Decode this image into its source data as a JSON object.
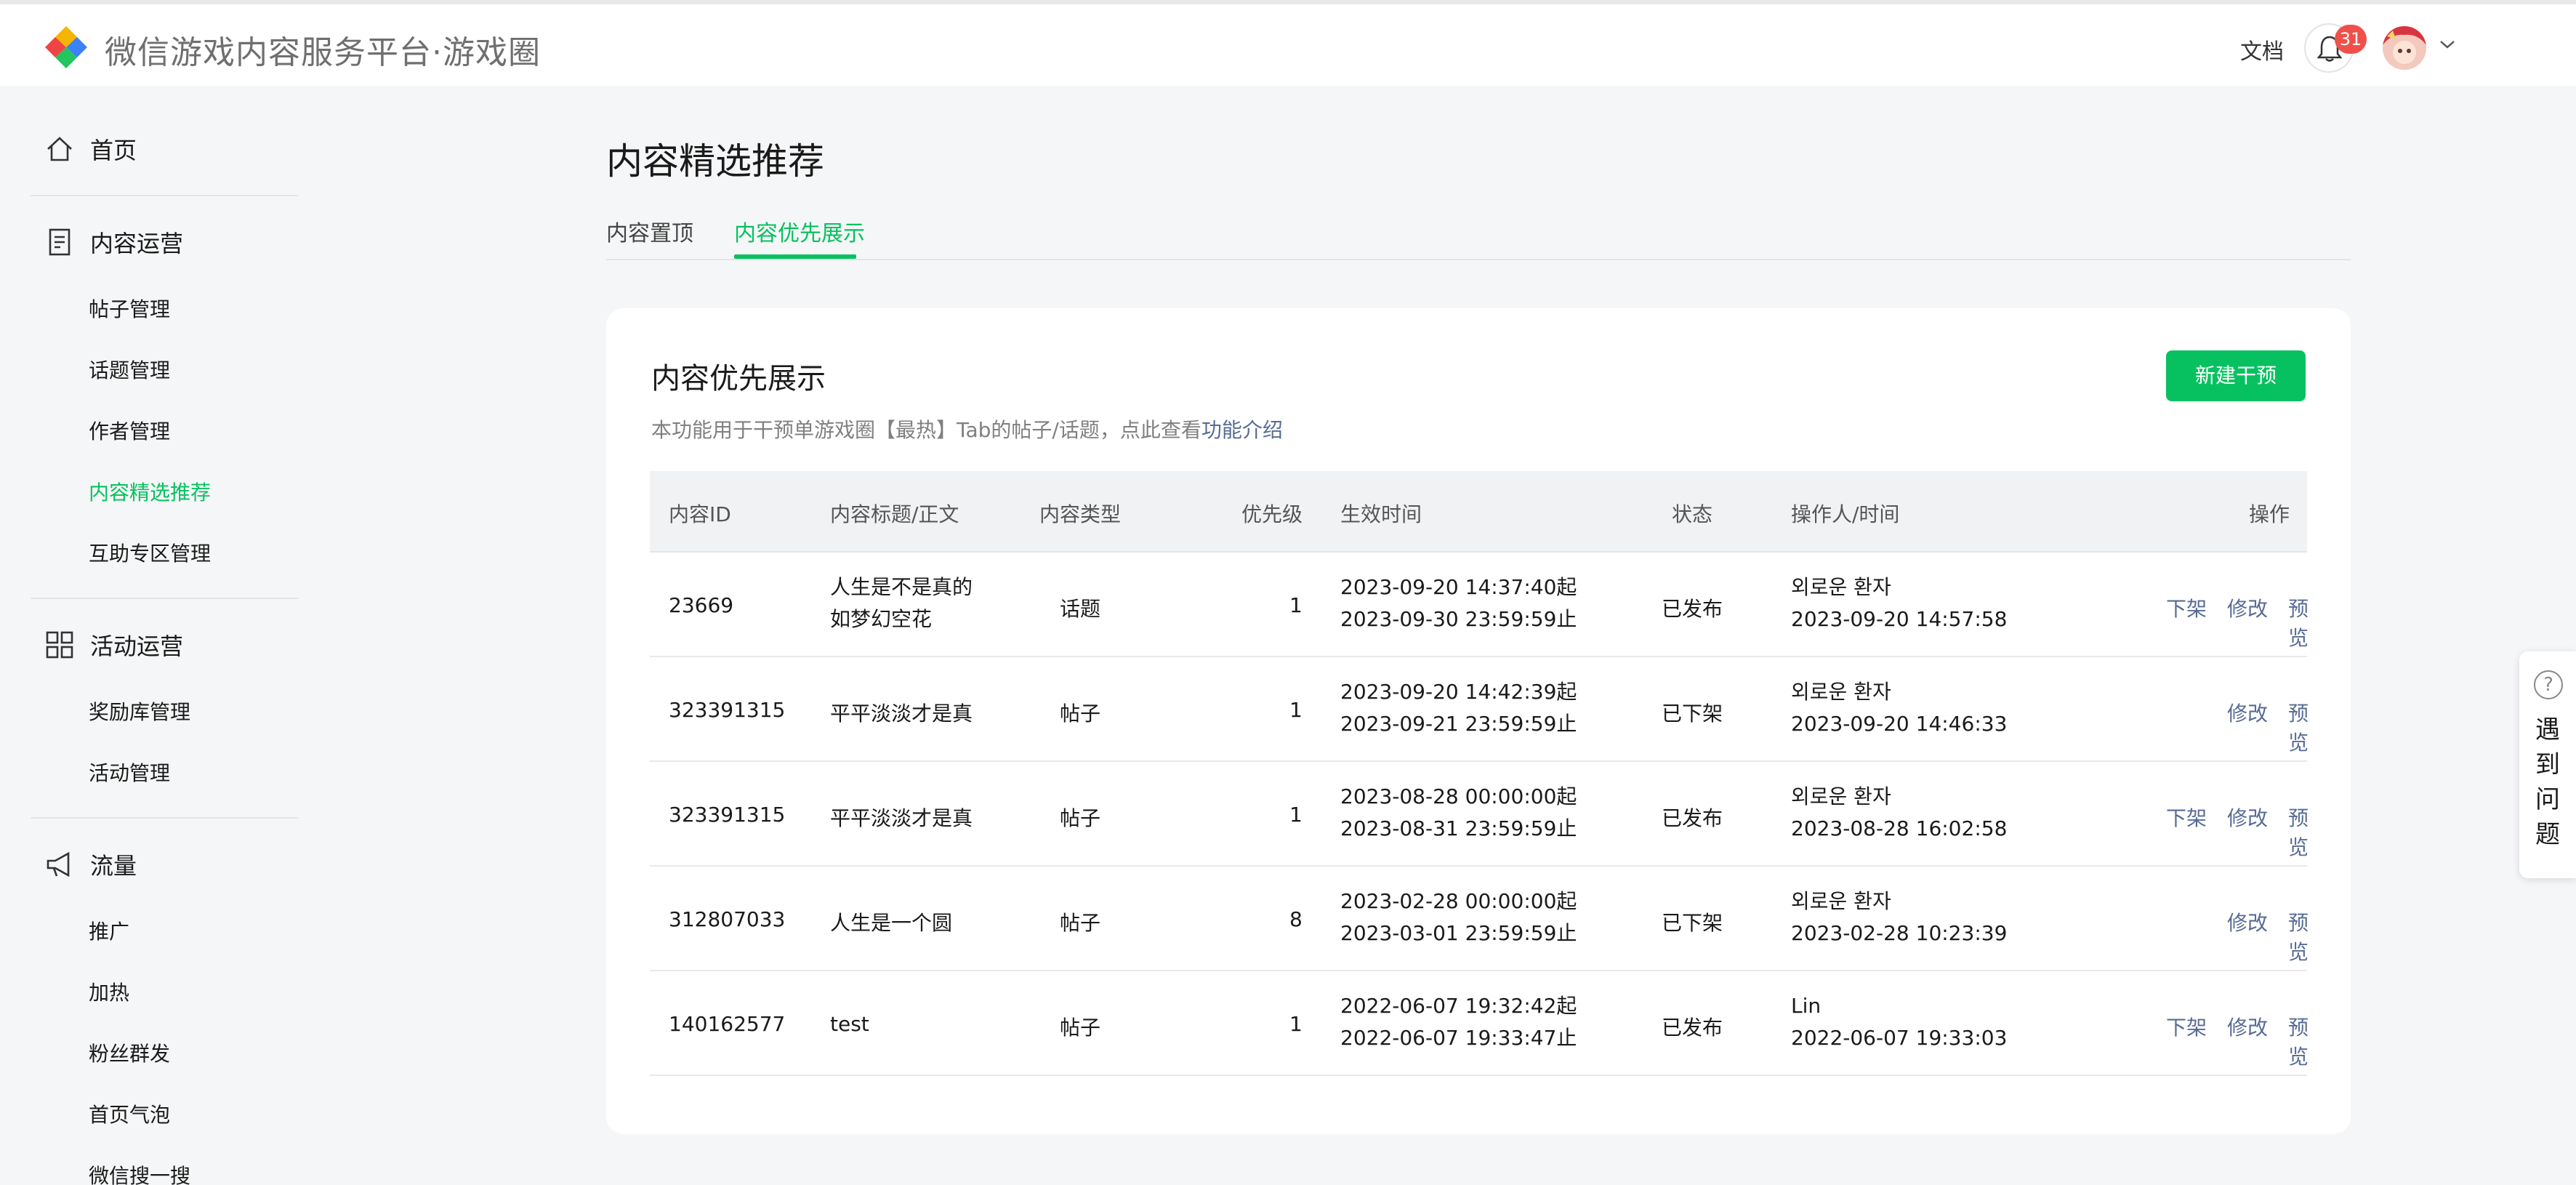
{
  "header": {
    "app_title": "微信游戏内容服务平台·游戏圈",
    "doc_link": "文档",
    "notification_count": "31"
  },
  "sidebar": {
    "home": "首页",
    "groups": [
      {
        "title": "内容运营",
        "icon": "document-icon",
        "items": [
          "帖子管理",
          "话题管理",
          "作者管理",
          "内容精选推荐",
          "互助专区管理"
        ]
      },
      {
        "title": "活动运营",
        "icon": "grid-icon",
        "items": [
          "奖励库管理",
          "活动管理"
        ]
      },
      {
        "title": "流量",
        "icon": "megaphone-icon",
        "items": [
          "推广",
          "加热",
          "粉丝群发",
          "首页气泡",
          "微信搜一搜"
        ]
      }
    ],
    "active_item": "内容精选推荐"
  },
  "main": {
    "page_title": "内容精选推荐",
    "tabs": [
      {
        "label": "内容置顶",
        "active": false
      },
      {
        "label": "内容优先展示",
        "active": true
      }
    ],
    "card": {
      "title": "内容优先展示",
      "desc_prefix": "本功能用于干预单游戏圈【最热】Tab的帖子/话题，点此查看",
      "desc_link": "功能介绍",
      "new_button": "新建干预"
    },
    "table": {
      "columns": [
        "内容ID",
        "内容标题/正文",
        "内容类型",
        "优先级",
        "生效时间",
        "状态",
        "操作人/时间",
        "操作"
      ],
      "rows": [
        {
          "id": "23669",
          "title1": "人生是不是真的",
          "title2": "如梦幻空花",
          "type": "话题",
          "priority": "1",
          "start": "2023-09-20 14:37:40起",
          "end": "2023-09-30 23:59:59止",
          "status": "已发布",
          "operator": "외로운 환자",
          "op_time": "2023-09-20 14:57:58",
          "actions": [
            "下架",
            "修改",
            "预览"
          ]
        },
        {
          "id": "323391315",
          "title1": "平平淡淡才是真",
          "title2": "",
          "type": "帖子",
          "priority": "1",
          "start": "2023-09-20 14:42:39起",
          "end": "2023-09-21 23:59:59止",
          "status": "已下架",
          "operator": "외로운 환자",
          "op_time": "2023-09-20 14:46:33",
          "actions": [
            "修改",
            "预览"
          ]
        },
        {
          "id": "323391315",
          "title1": "平平淡淡才是真",
          "title2": "",
          "type": "帖子",
          "priority": "1",
          "start": "2023-08-28 00:00:00起",
          "end": "2023-08-31 23:59:59止",
          "status": "已发布",
          "operator": "외로운 환자",
          "op_time": "2023-08-28 16:02:58",
          "actions": [
            "下架",
            "修改",
            "预览"
          ]
        },
        {
          "id": "312807033",
          "title1": "人生是一个圆",
          "title2": "",
          "type": "帖子",
          "priority": "8",
          "start": "2023-02-28 00:00:00起",
          "end": "2023-03-01 23:59:59止",
          "status": "已下架",
          "operator": "외로운 환자",
          "op_time": "2023-02-28 10:23:39",
          "actions": [
            "修改",
            "预览"
          ]
        },
        {
          "id": "140162577",
          "title1": "test",
          "title2": "",
          "type": "帖子",
          "priority": "1",
          "start": "2022-06-07 19:32:42起",
          "end": "2022-06-07 19:33:47止",
          "status": "已发布",
          "operator": "Lin",
          "op_time": "2022-06-07 19:33:03",
          "actions": [
            "下架",
            "修改",
            "预览"
          ]
        }
      ]
    }
  },
  "help_float": {
    "label": "遇到问题",
    "chars": [
      "遇",
      "到",
      "问",
      "题"
    ]
  },
  "colors": {
    "accent": "#07c160",
    "link": "#576b95",
    "badge": "#f0504a"
  }
}
